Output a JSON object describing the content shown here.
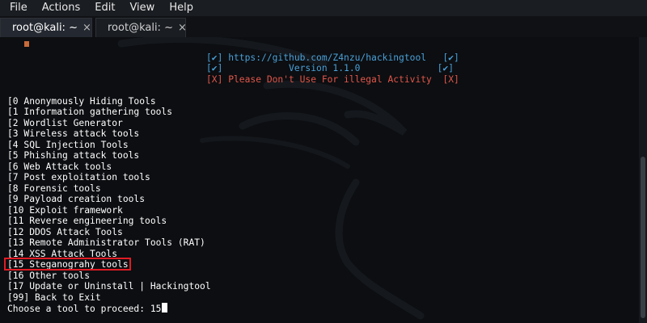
{
  "menubar": [
    "File",
    "Actions",
    "Edit",
    "View",
    "Help"
  ],
  "tabs": [
    {
      "label": "root@kali: ~",
      "close": "×",
      "active": true
    },
    {
      "label": "root@kali: ~",
      "close": "×",
      "active": false
    }
  ],
  "colors": {
    "header_blue": "#4aa0d8",
    "warning_red": "#e2564a",
    "highlight_box": "#e01b24",
    "menu_bg": "#1a1d21",
    "terminal_bg": "#0c0e11"
  },
  "header": [
    "[✔] https://github.com/Z4nzu/hackingtool   [✔]",
    "[✔]            Version 1.1.0              [✔]",
    "[X] Please Don't Use For illegal Activity  [X]"
  ],
  "menu_items": [
    "[0 Anonymously Hiding Tools",
    "[1 Information gathering tools",
    "[2 Wordlist Generator",
    "[3 Wireless attack tools",
    "[4 SQL Injection Tools",
    "[5 Phishing attack tools",
    "[6 Web Attack tools",
    "[7 Post exploitation tools",
    "[8 Forensic tools",
    "[9 Payload creation tools",
    "[10 Exploit framework",
    "[11 Reverse engineering tools",
    "[12 DDOS Attack Tools",
    "[13 Remote Administrator Tools (RAT)",
    "[14 XSS Attack Tools",
    "[15 Steganograhy tools",
    "[16 Other tools",
    "[17 Update or Uninstall | Hackingtool",
    "[99] Back to Exit"
  ],
  "prompt": {
    "text": "Choose a tool to proceed: ",
    "input": "15"
  }
}
